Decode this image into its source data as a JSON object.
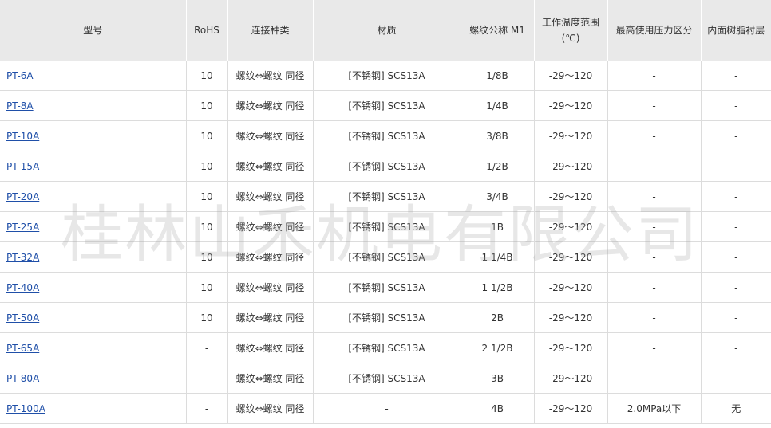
{
  "table": {
    "headers": [
      {
        "label": "型号"
      },
      {
        "label": "RoHS"
      },
      {
        "label": "连接种类"
      },
      {
        "label": "材质"
      },
      {
        "label": "螺纹公称 M1"
      },
      {
        "label": "工作温度范围",
        "sub": "(℃)"
      },
      {
        "label": "最高使用压力区分"
      },
      {
        "label": "内面树脂衬层"
      }
    ],
    "rows": [
      [
        "PT-6A",
        "10",
        "螺纹⇔螺纹 同径",
        "[不锈钢] SCS13A",
        "1/8B",
        "-29～120",
        "-",
        "-"
      ],
      [
        "PT-8A",
        "10",
        "螺纹⇔螺纹 同径",
        "[不锈钢] SCS13A",
        "1/4B",
        "-29～120",
        "-",
        "-"
      ],
      [
        "PT-10A",
        "10",
        "螺纹⇔螺纹 同径",
        "[不锈钢] SCS13A",
        "3/8B",
        "-29～120",
        "-",
        "-"
      ],
      [
        "PT-15A",
        "10",
        "螺纹⇔螺纹 同径",
        "[不锈钢] SCS13A",
        "1/2B",
        "-29～120",
        "-",
        "-"
      ],
      [
        "PT-20A",
        "10",
        "螺纹⇔螺纹 同径",
        "[不锈钢] SCS13A",
        "3/4B",
        "-29～120",
        "-",
        "-"
      ],
      [
        "PT-25A",
        "10",
        "螺纹⇔螺纹 同径",
        "[不锈钢] SCS13A",
        "1B",
        "-29～120",
        "-",
        "-"
      ],
      [
        "PT-32A",
        "10",
        "螺纹⇔螺纹 同径",
        "[不锈钢] SCS13A",
        "1 1/4B",
        "-29～120",
        "-",
        "-"
      ],
      [
        "PT-40A",
        "10",
        "螺纹⇔螺纹 同径",
        "[不锈钢] SCS13A",
        "1 1/2B",
        "-29～120",
        "-",
        "-"
      ],
      [
        "PT-50A",
        "10",
        "螺纹⇔螺纹 同径",
        "[不锈钢] SCS13A",
        "2B",
        "-29～120",
        "-",
        "-"
      ],
      [
        "PT-65A",
        "-",
        "螺纹⇔螺纹 同径",
        "[不锈钢] SCS13A",
        "2 1/2B",
        "-29～120",
        "-",
        "-"
      ],
      [
        "PT-80A",
        "-",
        "螺纹⇔螺纹 同径",
        "[不锈钢] SCS13A",
        "3B",
        "-29～120",
        "-",
        "-"
      ],
      [
        "PT-100A",
        "-",
        "螺纹⇔螺纹 同径",
        "-",
        "4B",
        "-29～120",
        "2.0MPa以下",
        "无"
      ]
    ]
  },
  "watermark": "桂林山禾机电有限公司",
  "colors": {
    "link": "#1f4fa8",
    "header_bg": "#e9e9e9",
    "border": "#dcdcdc"
  }
}
